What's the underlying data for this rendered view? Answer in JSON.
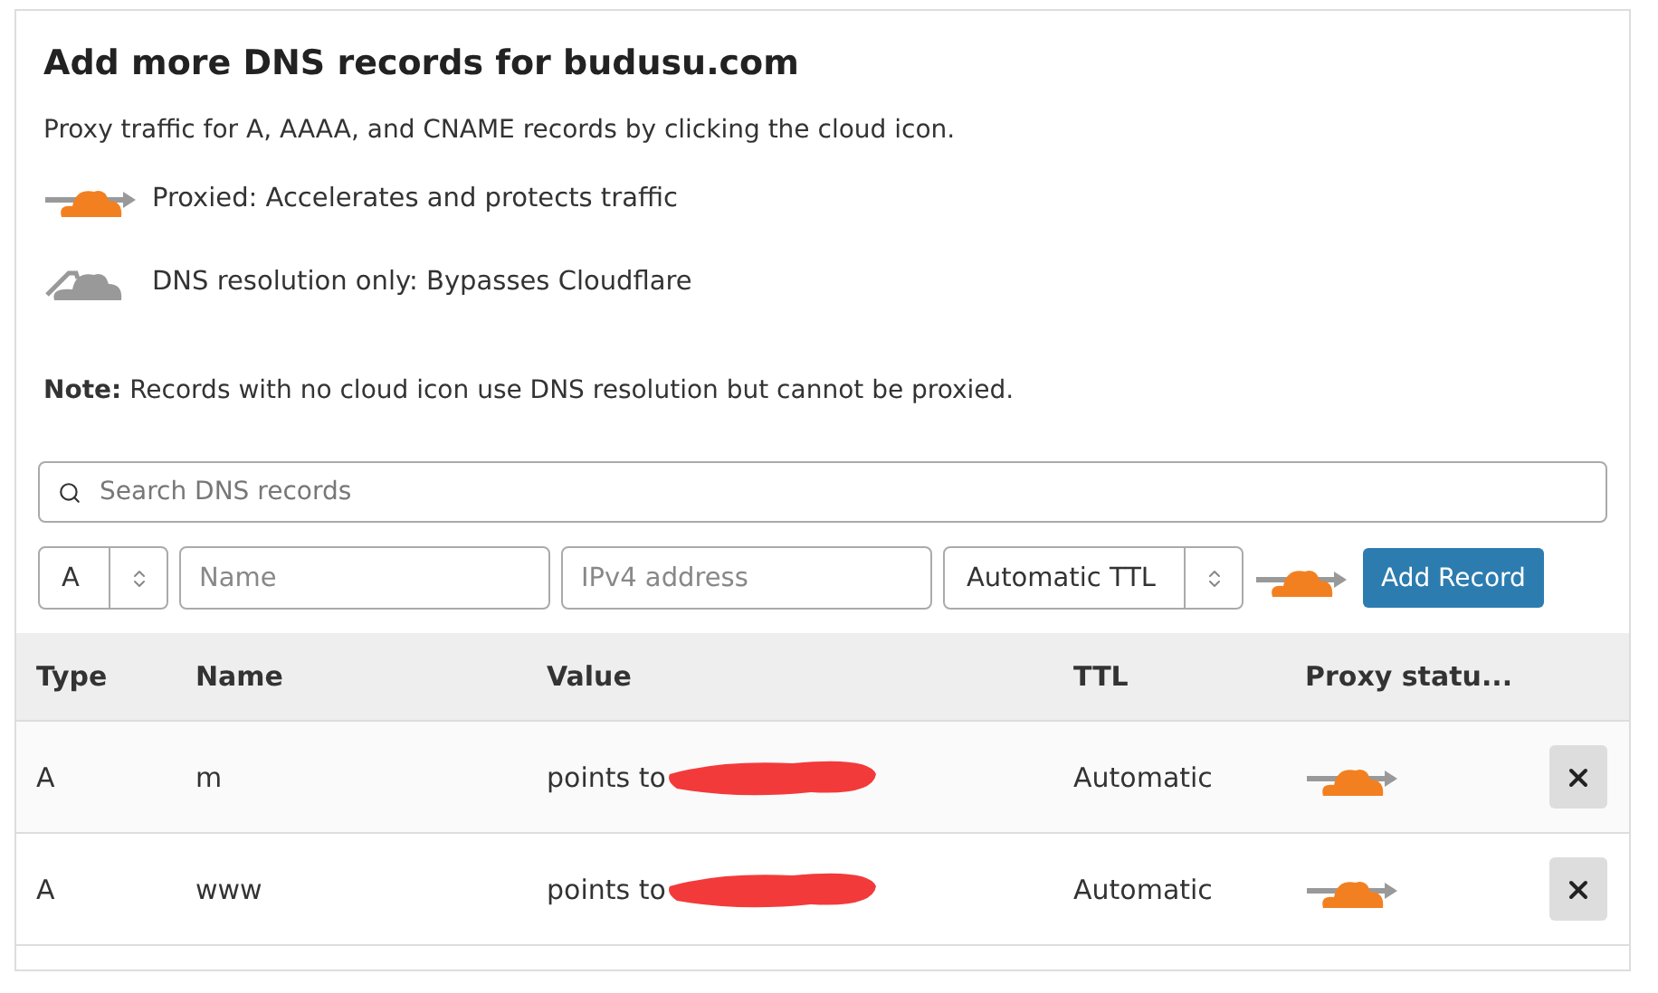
{
  "title": "Add more DNS records for budusu.com",
  "intro": "Proxy traffic for A, AAAA, and CNAME records by clicking the cloud icon.",
  "legend": [
    {
      "kind": "proxied",
      "text": "Proxied: Accelerates and protects traffic"
    },
    {
      "kind": "dns_only",
      "text": "DNS resolution only: Bypasses Cloudflare"
    }
  ],
  "note": "**Note:** Records with no cloud icon use DNS resolution but cannot be proxied.",
  "search": {
    "placeholder": "Search DNS records"
  },
  "form": {
    "type": "A",
    "name_placeholder": "Name",
    "value_placeholder": "IPv4 address",
    "ttl": "Automatic TTL",
    "proxied": true,
    "button": "Add Record"
  },
  "table": {
    "columns": [
      "Type",
      "Name",
      "Value",
      "TTL",
      "Proxy statu..."
    ],
    "rows": [
      {
        "type": "A",
        "name": "m",
        "value": "points to",
        "ttl": "Automatic",
        "proxied": true
      },
      {
        "type": "A",
        "name": "www",
        "value": "points to",
        "ttl": "Automatic",
        "proxied": true
      }
    ]
  }
}
